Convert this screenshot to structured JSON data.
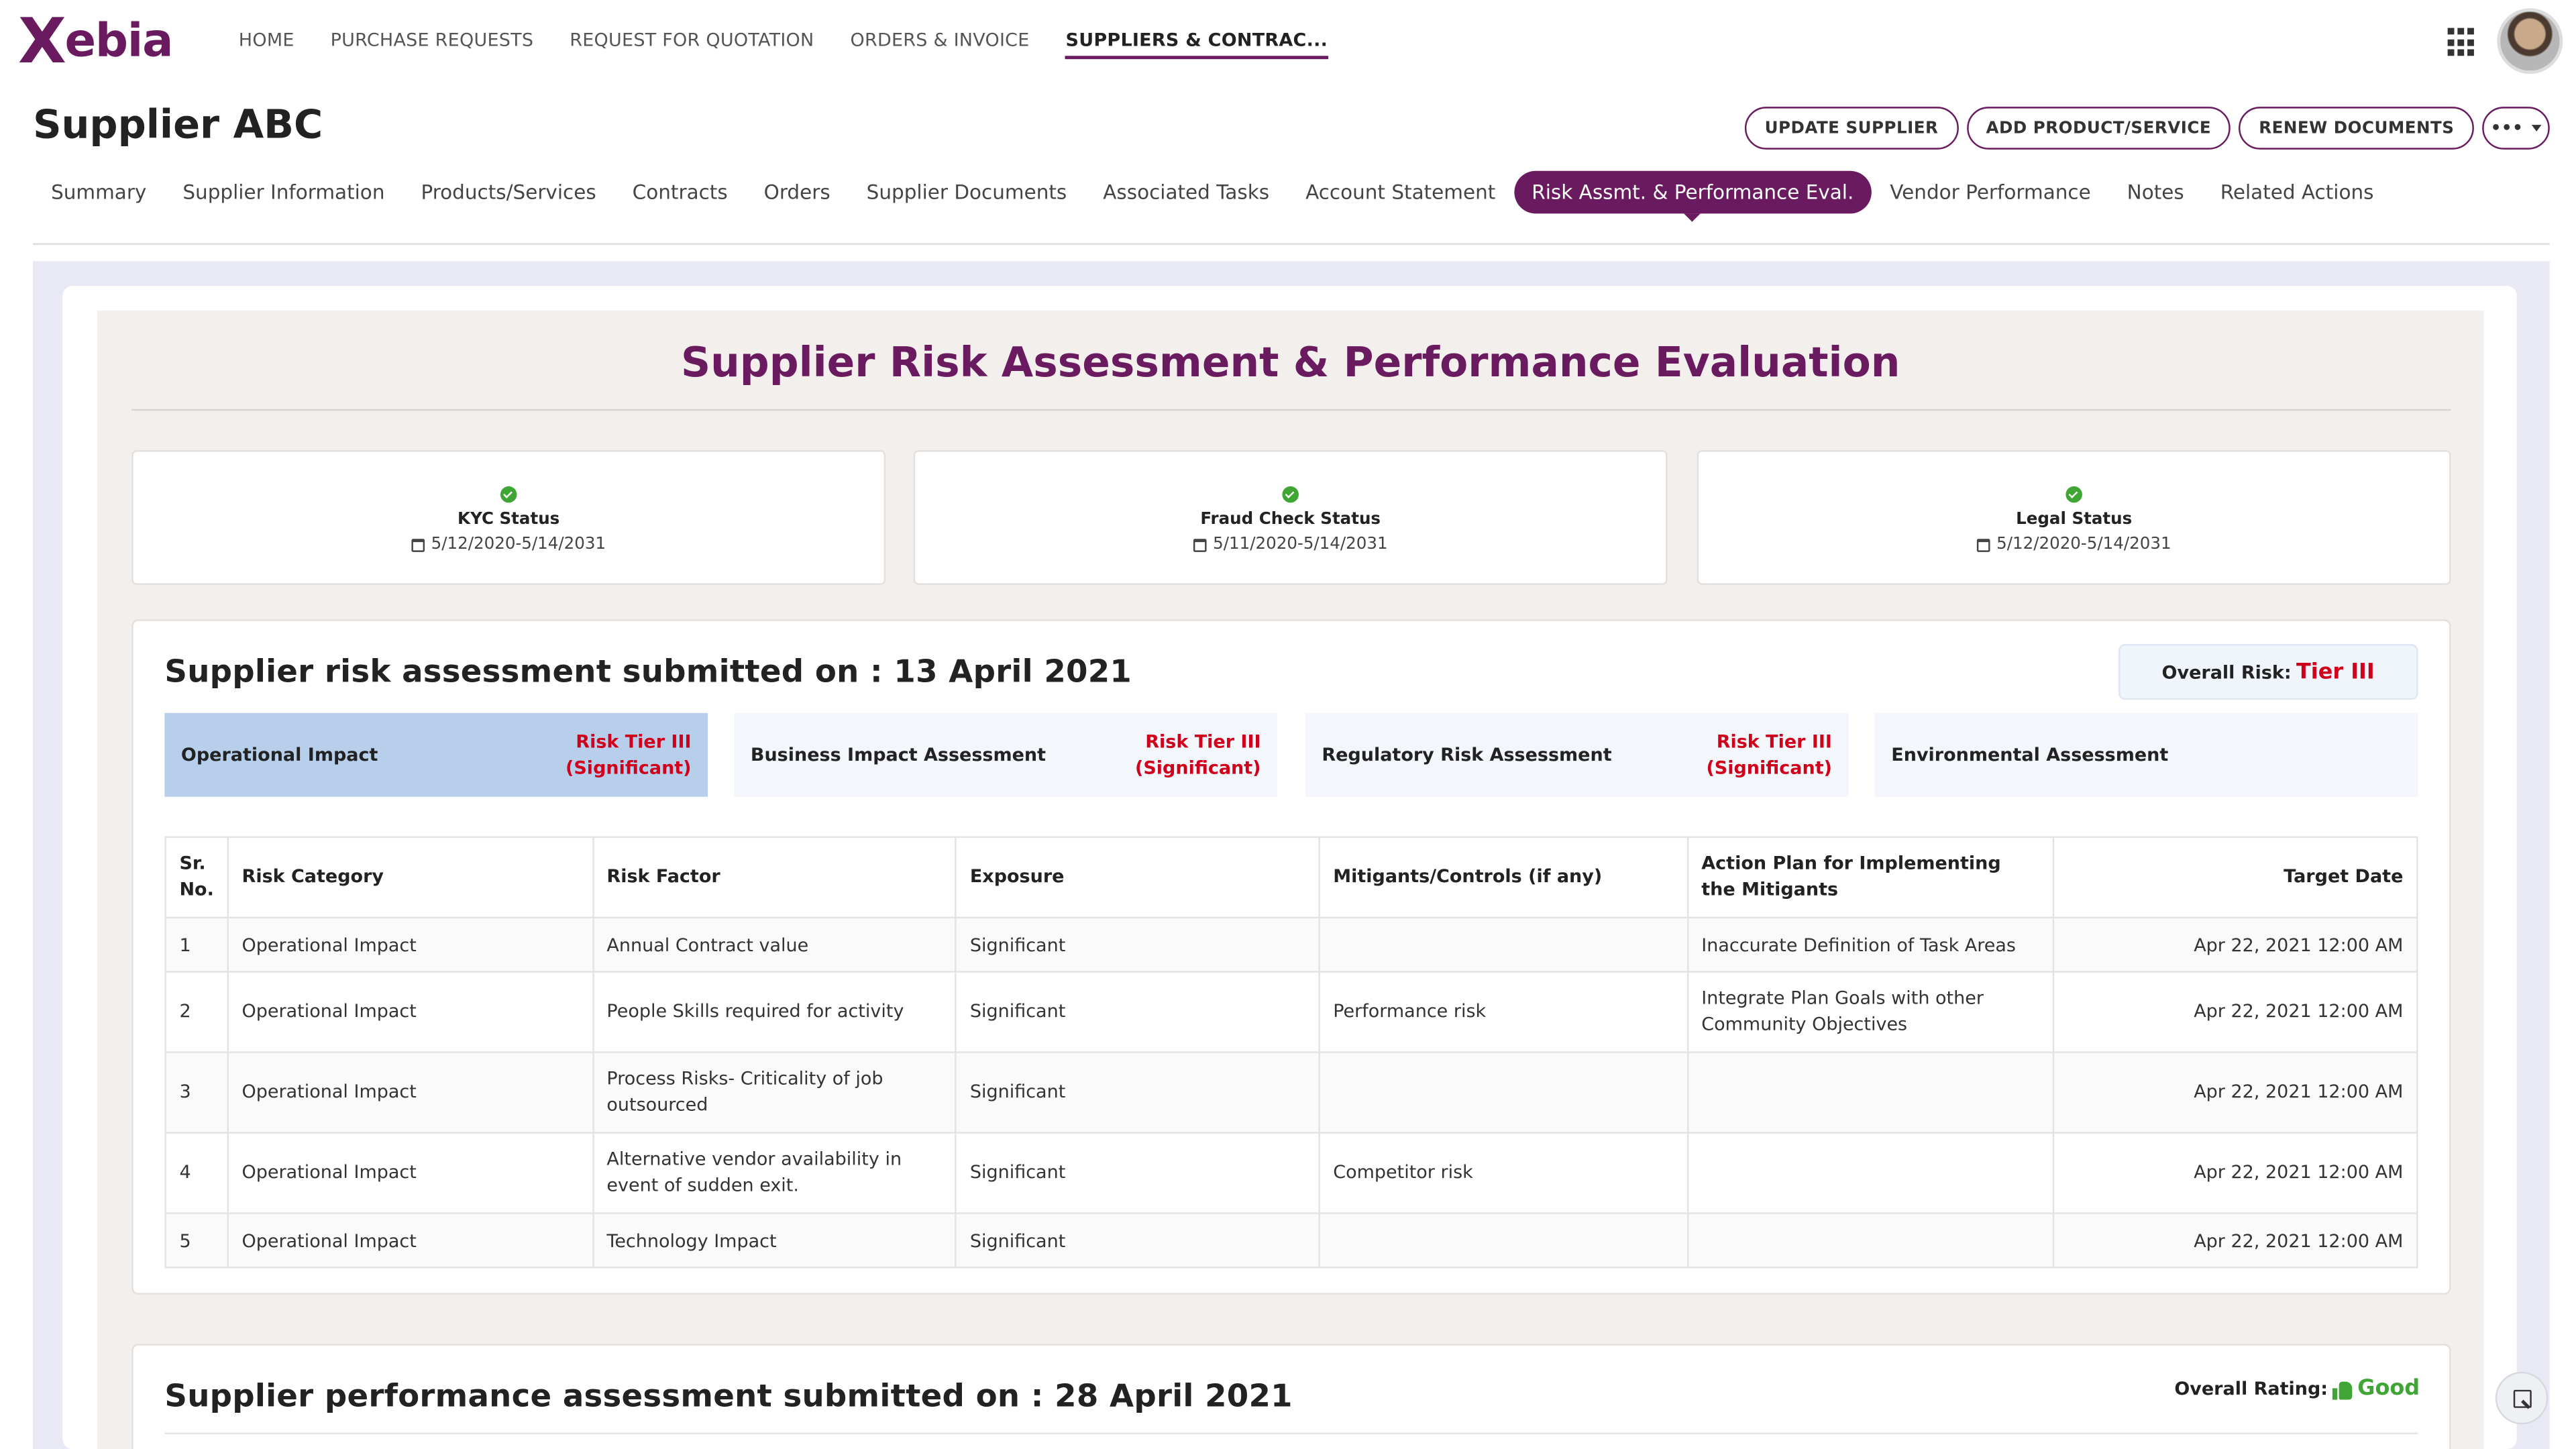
{
  "brand": {
    "logo_x": "X",
    "logo_rest": "ebia",
    "accent": "#6a1b5f"
  },
  "topnav": {
    "items": [
      "HOME",
      "PURCHASE REQUESTS",
      "REQUEST FOR QUOTATION",
      "ORDERS & INVOICE",
      "SUPPLIERS & CONTRAC..."
    ],
    "active": "SUPPLIERS & CONTRAC...",
    "apps_icon": "apps-grid-icon",
    "avatar_icon": "user-avatar"
  },
  "page": {
    "title": "Supplier ABC"
  },
  "actions": {
    "update": "UPDATE SUPPLIER",
    "add": "ADD PRODUCT/SERVICE",
    "renew": "RENEW DOCUMENTS",
    "more": "•••"
  },
  "subtabs": {
    "items": [
      "Summary",
      "Supplier Information",
      "Products/Services",
      "Contracts",
      "Orders",
      "Supplier Documents",
      "Associated Tasks",
      "Account Statement",
      "Risk Assmt. & Performance Eval.",
      "Vendor Performance",
      "Notes",
      "Related Actions"
    ],
    "active": "Risk Assmt. & Performance Eval."
  },
  "heading": "Supplier Risk Assessment & Performance Evaluation",
  "status_cards": [
    {
      "label": "KYC Status",
      "date": "5/12/2020-5/14/2031"
    },
    {
      "label": "Fraud Check Status",
      "date": "5/11/2020-5/14/2031"
    },
    {
      "label": "Legal Status",
      "date": "5/12/2020-5/14/2031"
    }
  ],
  "risk": {
    "title": "Supplier risk assessment submitted on : 13 April 2021",
    "overall_label": "Overall Risk:",
    "overall_value": "Tier III",
    "categories": [
      {
        "name": "Operational Impact",
        "tier_line1": "Risk Tier III",
        "tier_line2": "(Significant)",
        "active": true
      },
      {
        "name": "Business Impact Assessment",
        "tier_line1": "Risk Tier III",
        "tier_line2": "(Significant)"
      },
      {
        "name": "Regulatory Risk Assessment",
        "tier_line1": "Risk Tier III",
        "tier_line2": "(Significant)"
      },
      {
        "name": "Environmental Assessment",
        "tier_line1": "",
        "tier_line2": ""
      }
    ],
    "columns": [
      "Sr. No.",
      "Risk Category",
      "Risk Factor",
      "Exposure",
      "Mitigants/Controls (if any)",
      "Action Plan for Implementing the Mitigants",
      "Target Date"
    ],
    "rows": [
      {
        "no": "1",
        "category": "Operational Impact",
        "factor": "Annual Contract value",
        "exposure": "Significant",
        "mitigants": "",
        "plan": "Inaccurate Definition of Task Areas",
        "date": "Apr 22, 2021 12:00 AM"
      },
      {
        "no": "2",
        "category": "Operational Impact",
        "factor": "People Skills required for activity",
        "exposure": "Significant",
        "mitigants": "Performance risk",
        "plan": "Integrate Plan Goals with other Community Objectives",
        "date": "Apr 22, 2021 12:00 AM"
      },
      {
        "no": "3",
        "category": "Operational Impact",
        "factor": "Process Risks- Criticality of job outsourced",
        "exposure": "Significant",
        "mitigants": "",
        "plan": "",
        "date": "Apr 22, 2021 12:00 AM"
      },
      {
        "no": "4",
        "category": "Operational Impact",
        "factor": "Alternative vendor availability in event of sudden exit.",
        "exposure": "Significant",
        "mitigants": "Competitor risk",
        "plan": "",
        "date": "Apr 22, 2021 12:00 AM"
      },
      {
        "no": "5",
        "category": "Operational Impact",
        "factor": "Technology Impact",
        "exposure": "Significant",
        "mitigants": "",
        "plan": "",
        "date": "Apr 22, 2021 12:00 AM"
      }
    ]
  },
  "performance": {
    "title": "Supplier performance assessment submitted on : 28 April 2021",
    "overall_label": "Overall Rating:",
    "overall_value": "Good"
  },
  "colors": {
    "red": "#d0021b",
    "green": "#3fa535",
    "tab_active_bg": "#b8cfec"
  }
}
